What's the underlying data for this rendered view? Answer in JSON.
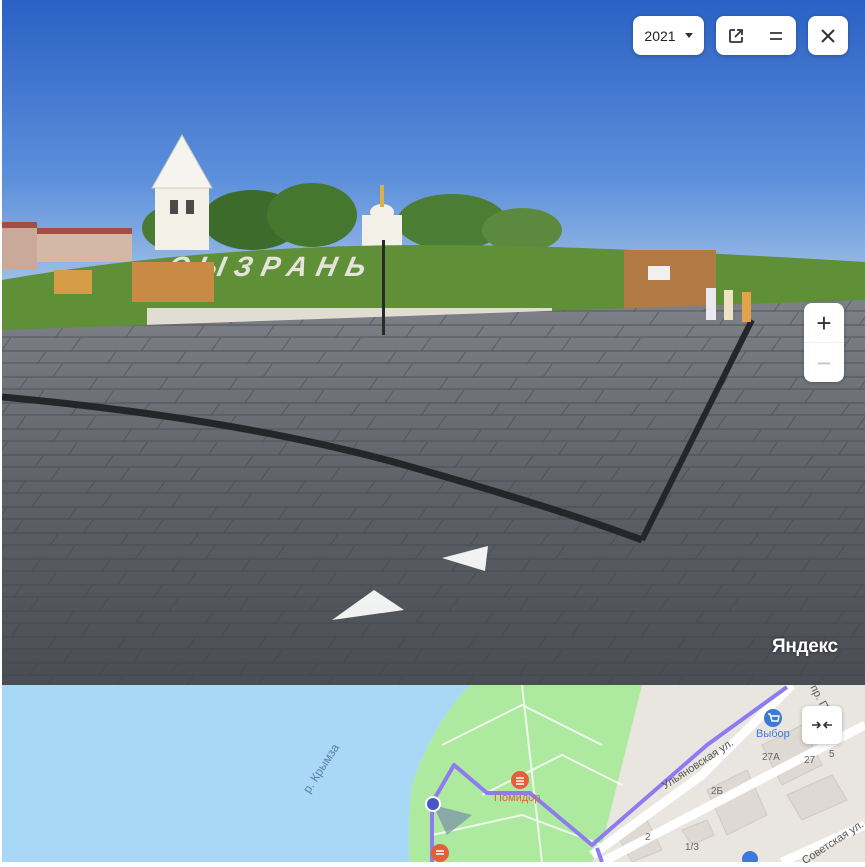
{
  "panorama": {
    "year_selector": {
      "value": "2021",
      "icon": "chevron-down-icon"
    },
    "toolbar": {
      "open_external_icon": "external-link-icon",
      "menu_icon": "equals-icon"
    },
    "close_icon": "close-icon",
    "zoom": {
      "in_label": "+",
      "out_label": "−"
    },
    "sign_text": "СЫЗРАНЬ",
    "logo": "Яндекс"
  },
  "map": {
    "river_label": "р. Крымза",
    "streets": [
      "Ульяновская ул.",
      "Советская ул.",
      "пр. Постол"
    ],
    "pois": [
      {
        "name": "Выбор",
        "icon": "shopping-cart-icon",
        "color": "#3d79d6"
      },
      {
        "name": "Помидор",
        "icon": "food-icon",
        "color": "#e2613a"
      }
    ],
    "buildings": [
      "27А",
      "27",
      "5",
      "2Б",
      "2",
      "1/3"
    ],
    "collapse_icon": "collapse-arrows-icon",
    "colors": {
      "water": "#a8d8f6",
      "park": "#aee9a0",
      "route": "#8f7bf0"
    }
  }
}
